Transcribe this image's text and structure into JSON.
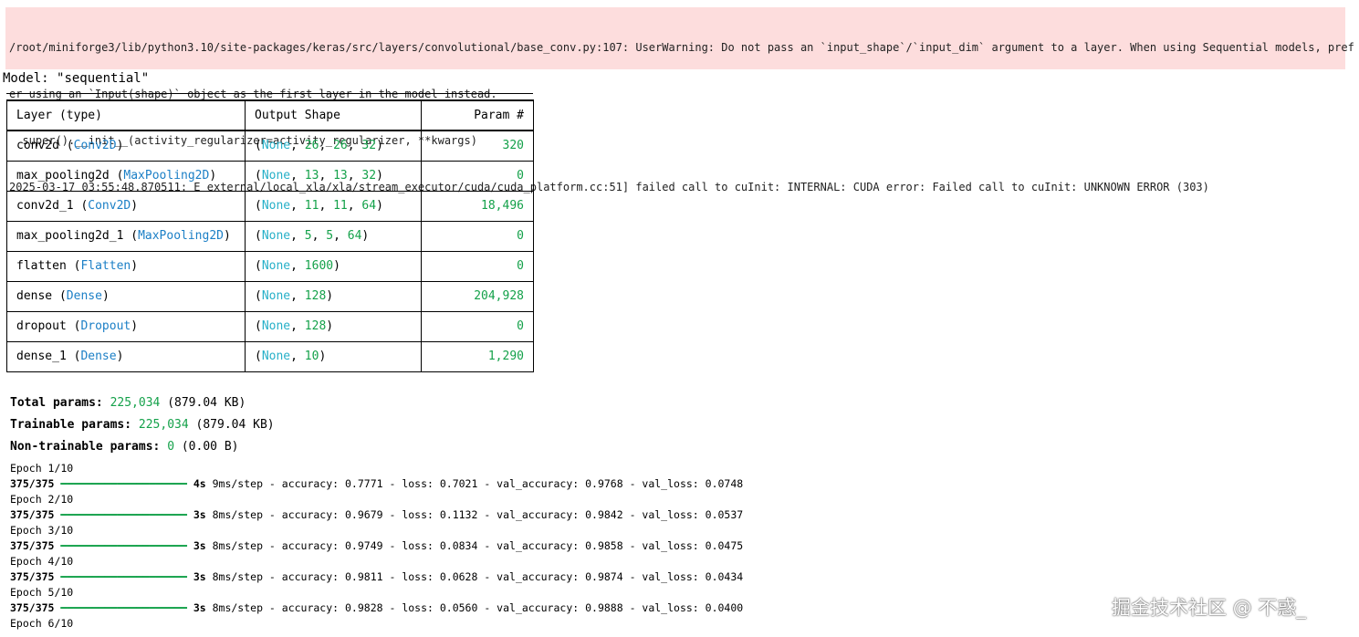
{
  "stderr": {
    "lines": [
      "/root/miniforge3/lib/python3.10/site-packages/keras/src/layers/convolutional/base_conv.py:107: UserWarning: Do not pass an `input_shape`/`input_dim` argument to a layer. When using Sequential models, pref",
      "er using an `Input(shape)` object as the first layer in the model instead.",
      "  super().__init__(activity_regularizer=activity_regularizer, **kwargs)",
      "2025-03-17 03:55:48.870511: E external/local_xla/xla/stream_executor/cuda/cuda_platform.cc:51] failed call to cuInit: INTERNAL: CUDA error: Failed call to cuInit: UNKNOWN ERROR (303)"
    ]
  },
  "model": {
    "title_prefix": "Model: ",
    "name": "\"sequential\""
  },
  "summary": {
    "headers": [
      "Layer (type)",
      "Output Shape",
      "Param #"
    ],
    "rows": [
      {
        "name": "conv2d",
        "type": "Conv2D",
        "shape": [
          "None",
          "26",
          "26",
          "32"
        ],
        "params": "320"
      },
      {
        "name": "max_pooling2d",
        "type": "MaxPooling2D",
        "shape": [
          "None",
          "13",
          "13",
          "32"
        ],
        "params": "0"
      },
      {
        "name": "conv2d_1",
        "type": "Conv2D",
        "shape": [
          "None",
          "11",
          "11",
          "64"
        ],
        "params": "18,496"
      },
      {
        "name": "max_pooling2d_1",
        "type": "MaxPooling2D",
        "shape": [
          "None",
          "5",
          "5",
          "64"
        ],
        "params": "0"
      },
      {
        "name": "flatten",
        "type": "Flatten",
        "shape": [
          "None",
          "1600"
        ],
        "params": "0"
      },
      {
        "name": "dense",
        "type": "Dense",
        "shape": [
          "None",
          "128"
        ],
        "params": "204,928"
      },
      {
        "name": "dropout",
        "type": "Dropout",
        "shape": [
          "None",
          "128"
        ],
        "params": "0"
      },
      {
        "name": "dense_1",
        "type": "Dense",
        "shape": [
          "None",
          "10"
        ],
        "params": "1,290"
      }
    ]
  },
  "totals": [
    {
      "label": "Total params:",
      "value": "225,034",
      "size": "(879.04 KB)"
    },
    {
      "label": "Trainable params:",
      "value": "225,034",
      "size": "(879.04 KB)"
    },
    {
      "label": "Non-trainable params:",
      "value": "0",
      "size": "(0.00 B)"
    }
  ],
  "training": [
    {
      "epoch": "Epoch 1/10",
      "steps": "375/375",
      "bar": "━━━━━━━━━━━━━━━━━━━━",
      "time": "4s",
      "rest": " 9ms/step - accuracy: 0.7771 - loss: 0.7021 - val_accuracy: 0.9768 - val_loss: 0.0748"
    },
    {
      "epoch": "Epoch 2/10",
      "steps": "375/375",
      "bar": "━━━━━━━━━━━━━━━━━━━━",
      "time": "3s",
      "rest": " 8ms/step - accuracy: 0.9679 - loss: 0.1132 - val_accuracy: 0.9842 - val_loss: 0.0537"
    },
    {
      "epoch": "Epoch 3/10",
      "steps": "375/375",
      "bar": "━━━━━━━━━━━━━━━━━━━━",
      "time": "3s",
      "rest": " 8ms/step - accuracy: 0.9749 - loss: 0.0834 - val_accuracy: 0.9858 - val_loss: 0.0475"
    },
    {
      "epoch": "Epoch 4/10",
      "steps": "375/375",
      "bar": "━━━━━━━━━━━━━━━━━━━━",
      "time": "3s",
      "rest": " 8ms/step - accuracy: 0.9811 - loss: 0.0628 - val_accuracy: 0.9874 - val_loss: 0.0434"
    },
    {
      "epoch": "Epoch 5/10",
      "steps": "375/375",
      "bar": "━━━━━━━━━━━━━━━━━━━━",
      "time": "3s",
      "rest": " 8ms/step - accuracy: 0.9828 - loss: 0.0560 - val_accuracy: 0.9888 - val_loss: 0.0400"
    },
    {
      "epoch": "Epoch 6/10",
      "steps": "",
      "bar": "",
      "time": "",
      "rest": ""
    }
  ],
  "watermark": "掘金技术社区 @ 不惑_",
  "colors": {
    "stderr_bg": "#fddddd",
    "class_name": "#1b7fc6",
    "none_value": "#27b0c8",
    "number": "#14a14a"
  }
}
